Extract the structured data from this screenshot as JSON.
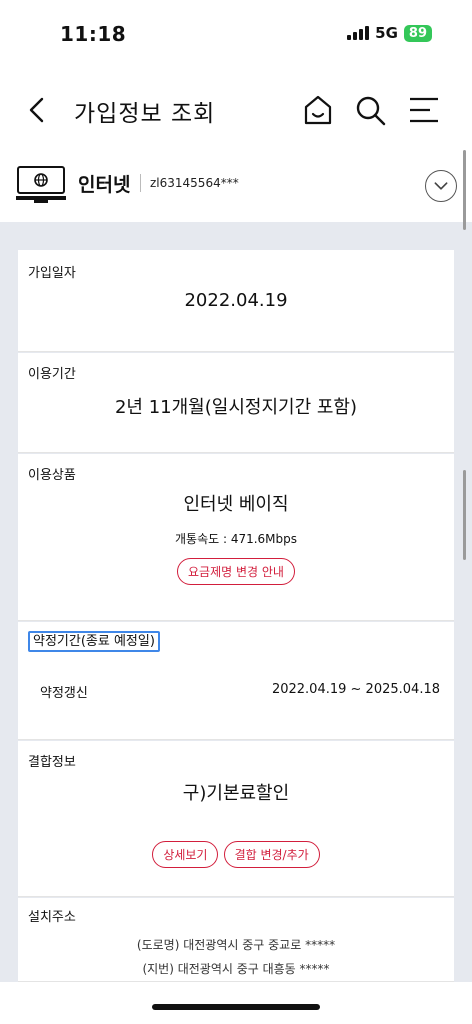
{
  "status_bar": {
    "time": "11:18",
    "network": "5G",
    "battery": "89"
  },
  "nav": {
    "title": "가입정보 조회"
  },
  "service": {
    "name": "인터넷",
    "id": "zl63145564***"
  },
  "cards": {
    "join_date": {
      "label": "가입일자",
      "value": "2022.04.19"
    },
    "usage_period": {
      "label": "이용기간",
      "value": "2년 11개월(일시정지기간 포함)"
    },
    "product": {
      "label": "이용상품",
      "name": "인터넷 베이직",
      "speed": "개통속도 : 471.6Mbps",
      "rate_plan_button": "요금제명 변경 안내"
    },
    "contract": {
      "label": "약정기간(종료 예정일)",
      "row_label": "약정갱신",
      "row_value": "2022.04.19 ~ 2025.04.18"
    },
    "bundle": {
      "label": "결합정보",
      "value": "구)기본료할인",
      "detail_button": "상세보기",
      "change_button": "결합 변경/추가"
    },
    "address": {
      "label": "설치주소",
      "road": "(도로명) 대전광역시 중구 중교로 *****",
      "lot": "(지번) 대전광역시 중구 대흥동 *****"
    }
  },
  "colors": {
    "accent_red": "#d21e3c",
    "focus_blue": "#3f87e8",
    "background": "#e6e9ef",
    "battery_green": "#34c759"
  }
}
